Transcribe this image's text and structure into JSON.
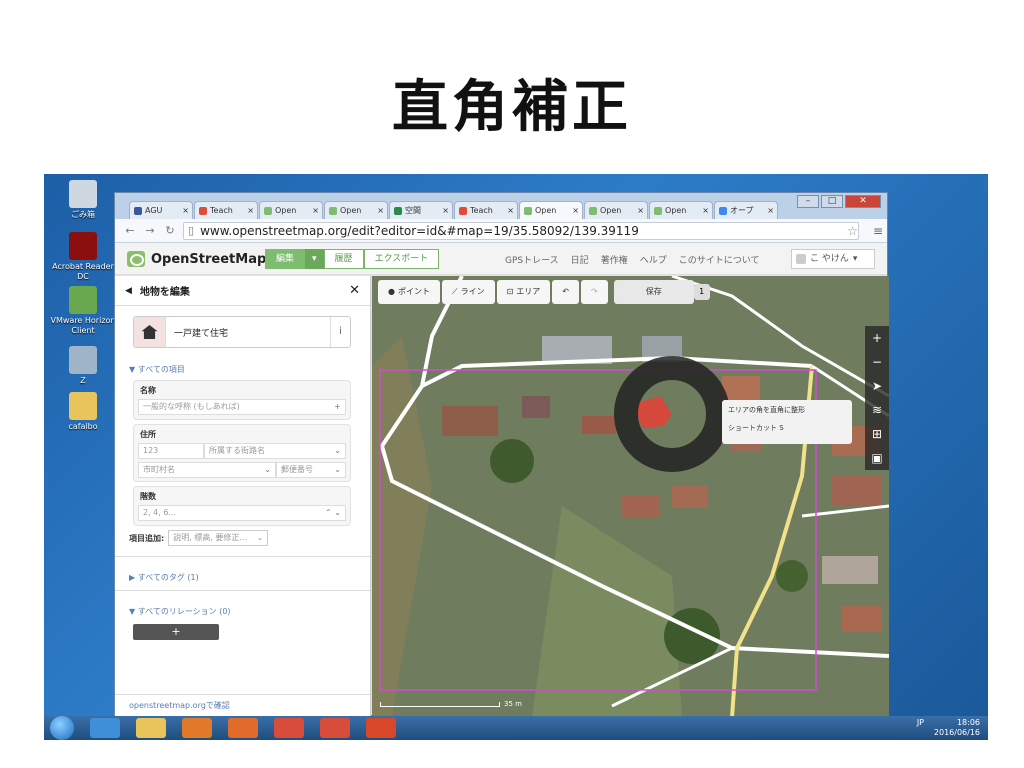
{
  "slide": {
    "title": "直角補正"
  },
  "desktop": {
    "icons": [
      {
        "label": "ごみ箱"
      },
      {
        "label": "Acrobat Reader DC"
      },
      {
        "label": "VMware Horizon Client"
      },
      {
        "label": "Z"
      },
      {
        "label": "cafalbo"
      }
    ]
  },
  "browser": {
    "tabs": [
      {
        "label": "AGU",
        "color": "#3b5998"
      },
      {
        "label": "Teach",
        "color": "#e04b3a"
      },
      {
        "label": "Open",
        "color": "#7ebc6f"
      },
      {
        "label": "Open",
        "color": "#7ebc6f"
      },
      {
        "label": "空間",
        "color": "#2a8a4a"
      },
      {
        "label": "Teach",
        "color": "#e04b3a"
      },
      {
        "label": "Open",
        "color": "#7ebc6f"
      },
      {
        "label": "Open",
        "color": "#7ebc6f"
      },
      {
        "label": "Open",
        "color": "#7ebc6f"
      },
      {
        "label": "オープ",
        "color": "#4285f4"
      }
    ],
    "url": "www.openstreetmap.org/edit?editor=id&#map=19/35.58092/139.39119"
  },
  "osm": {
    "logo": "OpenStreetMap",
    "edit": "編集",
    "history": "履歴",
    "export": "エクスポート",
    "links": [
      "GPSトレース",
      "日記",
      "著作権",
      "ヘルプ",
      "このサイトについて"
    ],
    "user": "こ やけん"
  },
  "sidebar": {
    "header": "地物を編集",
    "preset_name": "一戸建て住宅",
    "all_fields": "▼ すべての項目",
    "name_label": "名称",
    "name_placeholder": "一般的な呼称 (もしあれば)",
    "address_label": "住所",
    "housenumber": "123",
    "street": "所属する街路名",
    "city": "市町村名",
    "postcode": "郵便番号",
    "levels_label": "階数",
    "levels_placeholder": "2, 4, 6...",
    "add_field_label": "項目追加:",
    "add_field_placeholder": "説明, 標高, 要修正...",
    "all_tags": "▶ すべてのタグ (1)",
    "all_relations": "▼ すべてのリレーション (0)",
    "plus": "+",
    "footer": "openstreetmap.orgで確認"
  },
  "map": {
    "tools": {
      "point": "ポイント",
      "line": "ライン",
      "area": "エリア",
      "save": "保存",
      "count": "1"
    },
    "tooltip": {
      "text": "エリアの角を直角に整形",
      "shortcut": "ショートカット S"
    },
    "scale": "35 m"
  },
  "taskbar": {
    "time": "18:06",
    "date": "2016/06/16",
    "ime": "JP"
  }
}
